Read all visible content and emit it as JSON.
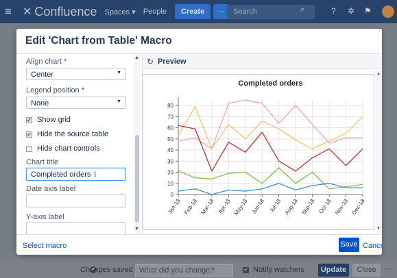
{
  "topnav": {
    "logo": "Confluence",
    "spaces": "Spaces",
    "people": "People",
    "create": "Create",
    "more": "···",
    "search_placeholder": "Search"
  },
  "modal": {
    "title": "Edit 'Chart from Table' Macro",
    "form": {
      "align_label": "Align chart *",
      "align_value": "Center",
      "legend_label": "Legend position *",
      "legend_value": "None",
      "show_grid": "Show grid",
      "hide_source": "Hide the source table",
      "hide_controls": "Hide chart controls",
      "chart_title_label": "Chart title",
      "chart_title_value": "Completed orders",
      "date_axis_label": "Date axis label",
      "date_axis_value": "",
      "y_axis_label": "Y-axis label",
      "y_axis_value": ""
    },
    "preview_label": "Preview",
    "footer": {
      "select_macro": "Select macro",
      "save": "Save",
      "cancel": "Cancel"
    }
  },
  "bottombar": {
    "saved": "Changes saved",
    "change_placeholder": "What did you change?",
    "notify": "Notify watchers",
    "update": "Update",
    "close": "Close",
    "more": "···"
  },
  "chart_data": {
    "type": "line",
    "title": "Completed orders",
    "categories": [
      "Jan-18",
      "Feb-18",
      "Mar-18",
      "Apr-18",
      "May-18",
      "Jun-18",
      "Jul-18",
      "Aug-18",
      "Sep-18",
      "Oct-18",
      "Nov-18",
      "Dec-18"
    ],
    "ylim": [
      0,
      85
    ],
    "yticks": [
      0,
      10,
      20,
      30,
      40,
      50,
      60,
      70,
      80
    ],
    "grid": true,
    "legend": "none",
    "series": [
      {
        "color": "#f4a3b3",
        "values": [
          48,
          51,
          41,
          82,
          85,
          82,
          64,
          80,
          63,
          46,
          51,
          51
        ]
      },
      {
        "color": "#f5c36b",
        "values": [
          53,
          79,
          41,
          63,
          50,
          66,
          59,
          49,
          41,
          48,
          55,
          70
        ]
      },
      {
        "color": "#cc2b2b",
        "values": [
          62,
          59,
          21,
          47,
          38,
          56,
          30,
          21,
          33,
          41,
          26,
          41
        ]
      },
      {
        "color": "#7dbb4a",
        "values": [
          21,
          15,
          14,
          19,
          20,
          10,
          24,
          10,
          20,
          5,
          7,
          9
        ]
      },
      {
        "color": "#3e8ecf",
        "values": [
          3,
          5,
          0,
          4,
          3,
          5,
          10,
          4,
          8,
          10,
          6,
          6
        ]
      }
    ]
  }
}
